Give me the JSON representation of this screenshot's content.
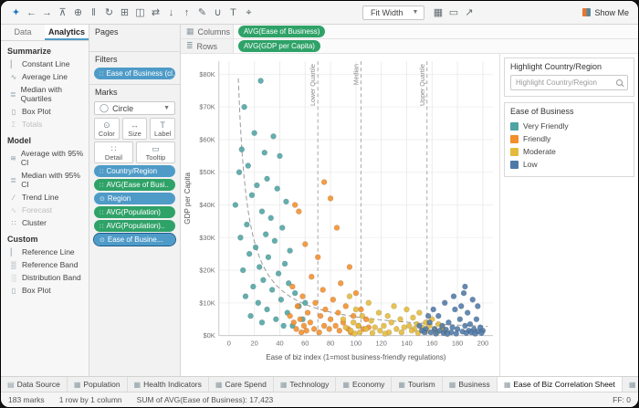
{
  "toolbar": {
    "left_icons": [
      {
        "name": "tableau-logo",
        "glyph": "✦",
        "color": "#1f79c0"
      },
      {
        "name": "undo-icon",
        "glyph": "←"
      },
      {
        "name": "redo-icon",
        "glyph": "→"
      },
      {
        "name": "save-icon",
        "glyph": "⊼"
      },
      {
        "name": "add-data-icon",
        "glyph": "⊕"
      },
      {
        "name": "pause-updates-icon",
        "glyph": "‖"
      },
      {
        "name": "refresh-icon",
        "glyph": "↻"
      },
      {
        "name": "new-worksheet-icon",
        "glyph": "⊞"
      },
      {
        "name": "duplicate-icon",
        "glyph": "◫"
      },
      {
        "name": "swap-axes-icon",
        "glyph": "⇄"
      },
      {
        "name": "sort-ascending-icon",
        "glyph": "↓"
      },
      {
        "name": "sort-descending-icon",
        "glyph": "↑"
      },
      {
        "name": "highlight-icon",
        "glyph": "✎"
      },
      {
        "name": "group-members-icon",
        "glyph": "∪"
      },
      {
        "name": "show-labels-icon",
        "glyph": "T"
      },
      {
        "name": "fix-axes-icon",
        "glyph": "⌖"
      }
    ],
    "fit_label": "Fit Width",
    "right_icons": [
      {
        "name": "show-hide-cards-icon",
        "glyph": "▦"
      },
      {
        "name": "presentation-mode-icon",
        "glyph": "▭"
      },
      {
        "name": "share-icon",
        "glyph": "↗"
      }
    ],
    "show_me_label": "Show Me"
  },
  "sidebar": {
    "tabs": [
      "Data",
      "Analytics"
    ],
    "sections": [
      {
        "title": "Summarize",
        "items": [
          {
            "label": "Constant Line",
            "icon": "constant-line-icon",
            "glyph": "▏",
            "disabled": false
          },
          {
            "label": "Average Line",
            "icon": "average-line-icon",
            "glyph": "∿",
            "disabled": false
          },
          {
            "label": "Median with Quartiles",
            "icon": "median-quartiles-icon",
            "glyph": "≣",
            "disabled": false
          },
          {
            "label": "Box Plot",
            "icon": "box-plot-icon",
            "glyph": "▯",
            "disabled": false
          },
          {
            "label": "Totals",
            "icon": "totals-icon",
            "glyph": "Σ",
            "disabled": true
          }
        ]
      },
      {
        "title": "Model",
        "items": [
          {
            "label": "Average with 95% CI",
            "icon": "average-ci-icon",
            "glyph": "≋",
            "disabled": false
          },
          {
            "label": "Median with 95% CI",
            "icon": "median-ci-icon",
            "glyph": "≣",
            "disabled": false
          },
          {
            "label": "Trend Line",
            "icon": "trend-line-icon",
            "glyph": "∕",
            "disabled": false
          },
          {
            "label": "Forecast",
            "icon": "forecast-icon",
            "glyph": "∿",
            "disabled": true
          },
          {
            "label": "Cluster",
            "icon": "cluster-icon",
            "glyph": "∷",
            "disabled": false
          }
        ]
      },
      {
        "title": "Custom",
        "items": [
          {
            "label": "Reference Line",
            "icon": "reference-line-icon",
            "glyph": "▏",
            "disabled": false
          },
          {
            "label": "Reference Band",
            "icon": "reference-band-icon",
            "glyph": "▒",
            "disabled": false
          },
          {
            "label": "Distribution Band",
            "icon": "distribution-band-icon",
            "glyph": "░",
            "disabled": false
          },
          {
            "label": "Box Plot",
            "icon": "box-plot-icon",
            "glyph": "▯",
            "disabled": false
          }
        ]
      }
    ]
  },
  "panel": {
    "pages_title": "Pages",
    "filters_title": "Filters",
    "filter_pill": "Ease of Business (cl..",
    "marks": {
      "title": "Marks",
      "mark_type": "Circle",
      "buttons_row1": [
        {
          "label": "Color",
          "icon": "color-icon",
          "glyph": "⊙"
        },
        {
          "label": "Size",
          "icon": "size-icon",
          "glyph": "↔"
        },
        {
          "label": "Label",
          "icon": "label-icon",
          "glyph": "T"
        }
      ],
      "buttons_row2": [
        {
          "label": "Detail",
          "icon": "detail-icon",
          "glyph": "∷"
        },
        {
          "label": "Tooltip",
          "icon": "tooltip-icon",
          "glyph": "▭"
        }
      ],
      "pills": [
        {
          "label": "Country/Region",
          "kind": "blue",
          "icon": "detail-icon",
          "glyph": "∷",
          "selected": false
        },
        {
          "label": "AVG(Ease of Busi..",
          "kind": "green",
          "icon": "detail-icon",
          "glyph": "∷",
          "selected": false
        },
        {
          "label": "Region",
          "kind": "blue",
          "icon": "color-icon",
          "glyph": "⊙",
          "selected": false
        },
        {
          "label": "AVG(Population)",
          "kind": "green",
          "icon": "detail-icon",
          "glyph": "∷",
          "selected": false
        },
        {
          "label": "AVG(Population)..",
          "kind": "green",
          "icon": "detail-icon",
          "glyph": "∷",
          "selected": false
        },
        {
          "label": "Ease of Busine...",
          "kind": "blue",
          "icon": "color-icon",
          "glyph": "⊙",
          "selected": true
        }
      ]
    }
  },
  "shelves": {
    "columns_label": "Columns",
    "rows_label": "Rows",
    "columns_pill": "AVG(Ease of Business)",
    "rows_pill": "AVG(GDP per Capita)"
  },
  "cards": {
    "highlight": {
      "title": "Highlight Country/Region",
      "placeholder": "Highlight Country/Region"
    },
    "legend": {
      "title": "Ease of Business",
      "items": [
        {
          "label": "Very Friendly",
          "color": "#4FA3A3"
        },
        {
          "label": "Friendly",
          "color": "#F28E2B"
        },
        {
          "label": "Moderate",
          "color": "#E3BA3C"
        },
        {
          "label": "Low",
          "color": "#4E79A7"
        }
      ]
    }
  },
  "tabs": {
    "items": [
      "Data Source",
      "Population",
      "Health Indicators",
      "Care Spend",
      "Technology",
      "Economy",
      "Tourism",
      "Business",
      "Ease of Biz Correlation Sheet",
      "Global Indicators"
    ],
    "active_index": 8,
    "right_icons": [
      {
        "name": "new-worksheet-tab-icon",
        "glyph": "⊞"
      },
      {
        "name": "new-dashboard-tab-icon",
        "glyph": "◫"
      },
      {
        "name": "new-story-tab-icon",
        "glyph": "▦"
      }
    ]
  },
  "status": {
    "left_items": [
      "183 marks",
      "1 row by 1 column",
      "SUM of AVG(Ease of Business): 17,423"
    ],
    "right_text": "FF: 0"
  },
  "chart_data": {
    "type": "scatter",
    "title": "",
    "xlabel": "Ease of biz index (1=most business-friendly regulations)",
    "ylabel": "GDP per Capita",
    "xlim": [
      -8,
      208
    ],
    "ylim": [
      0,
      84
    ],
    "x_ticks": [
      0,
      20,
      40,
      60,
      80,
      100,
      120,
      140,
      160,
      180,
      200
    ],
    "y_ticks": [
      0,
      10,
      20,
      30,
      40,
      50,
      60,
      70,
      80
    ],
    "y_tick_prefix": "$",
    "y_tick_suffix": "K",
    "grid": true,
    "legend_position": "right",
    "reference_lines": [
      {
        "x": 70,
        "label": "Lower Quartile"
      },
      {
        "x": 104,
        "label": "Median"
      },
      {
        "x": 156,
        "label": "Upper Quartile"
      }
    ],
    "trend_line": {
      "type": "power-decay",
      "k": 575,
      "x_start": 7.3,
      "x_end": 205,
      "style": "dashed"
    },
    "series": [
      {
        "name": "Very Friendly",
        "color": "#4FA3A3",
        "points": [
          [
            25,
            78
          ],
          [
            12,
            70
          ],
          [
            20,
            62
          ],
          [
            35,
            61
          ],
          [
            10,
            57
          ],
          [
            28,
            56
          ],
          [
            40,
            55
          ],
          [
            15,
            52
          ],
          [
            8,
            50
          ],
          [
            30,
            48
          ],
          [
            22,
            46
          ],
          [
            38,
            45
          ],
          [
            18,
            43
          ],
          [
            45,
            41
          ],
          [
            5,
            40
          ],
          [
            26,
            38
          ],
          [
            33,
            36
          ],
          [
            14,
            34
          ],
          [
            42,
            33
          ],
          [
            29,
            31
          ],
          [
            9,
            30
          ],
          [
            36,
            29
          ],
          [
            21,
            27
          ],
          [
            48,
            26
          ],
          [
            16,
            25
          ],
          [
            31,
            24
          ],
          [
            44,
            22
          ],
          [
            24,
            21
          ],
          [
            11,
            20
          ],
          [
            39,
            19
          ],
          [
            27,
            17
          ],
          [
            47,
            16
          ],
          [
            19,
            15
          ],
          [
            34,
            14
          ],
          [
            52,
            13
          ],
          [
            13,
            12
          ],
          [
            41,
            11
          ],
          [
            23,
            10
          ],
          [
            55,
            9
          ],
          [
            30,
            8
          ],
          [
            46,
            7
          ],
          [
            17,
            6
          ],
          [
            37,
            5
          ],
          [
            58,
            5
          ],
          [
            26,
            4
          ],
          [
            50,
            3
          ],
          [
            60,
            10
          ],
          [
            43,
            3
          ]
        ]
      },
      {
        "name": "Friendly",
        "color": "#F28E2B",
        "points": [
          [
            75,
            47
          ],
          [
            80,
            42
          ],
          [
            52,
            40
          ],
          [
            55,
            38
          ],
          [
            85,
            33
          ],
          [
            60,
            28
          ],
          [
            70,
            24
          ],
          [
            95,
            21
          ],
          [
            65,
            18
          ],
          [
            88,
            16
          ],
          [
            50,
            15
          ],
          [
            74,
            14
          ],
          [
            100,
            13
          ],
          [
            58,
            12
          ],
          [
            82,
            11
          ],
          [
            68,
            10
          ],
          [
            92,
            9
          ],
          [
            54,
            9
          ],
          [
            76,
            8
          ],
          [
            104,
            8
          ],
          [
            62,
            7
          ],
          [
            86,
            7
          ],
          [
            48,
            6
          ],
          [
            72,
            6
          ],
          [
            98,
            6
          ],
          [
            56,
            5
          ],
          [
            80,
            5
          ],
          [
            108,
            5
          ],
          [
            64,
            4
          ],
          [
            90,
            4
          ],
          [
            51,
            4
          ],
          [
            75,
            3
          ],
          [
            102,
            3
          ],
          [
            59,
            3
          ],
          [
            84,
            3
          ],
          [
            67,
            2
          ],
          [
            94,
            2
          ],
          [
            53,
            2
          ],
          [
            79,
            2
          ],
          [
            106,
            2
          ],
          [
            61,
            1.5
          ],
          [
            87,
            1.5
          ],
          [
            71,
            1
          ],
          [
            96,
            1
          ],
          [
            57,
            1
          ],
          [
            110,
            2.5
          ]
        ]
      },
      {
        "name": "Moderate",
        "color": "#E3BA3C",
        "points": [
          [
            95,
            12
          ],
          [
            110,
            10
          ],
          [
            130,
            9
          ],
          [
            100,
            8
          ],
          [
            140,
            8
          ],
          [
            118,
            7
          ],
          [
            150,
            7
          ],
          [
            105,
            6
          ],
          [
            125,
            6
          ],
          [
            145,
            5.5
          ],
          [
            160,
            5
          ],
          [
            90,
            5
          ],
          [
            135,
            5
          ],
          [
            112,
            4.5
          ],
          [
            155,
            4
          ],
          [
            98,
            4
          ],
          [
            128,
            4
          ],
          [
            148,
            3.5
          ],
          [
            165,
            3.5
          ],
          [
            102,
            3
          ],
          [
            122,
            3
          ],
          [
            142,
            3
          ],
          [
            158,
            3
          ],
          [
            92,
            2.5
          ],
          [
            115,
            2.5
          ],
          [
            138,
            2.5
          ],
          [
            152,
            2.5
          ],
          [
            168,
            2.5
          ],
          [
            108,
            2
          ],
          [
            132,
            2
          ],
          [
            146,
            2
          ],
          [
            162,
            2
          ],
          [
            96,
            1.5
          ],
          [
            119,
            1.5
          ],
          [
            144,
            1.5
          ],
          [
            156,
            1.5
          ],
          [
            103,
            1
          ],
          [
            126,
            1
          ],
          [
            136,
            1
          ],
          [
            164,
            1
          ],
          [
            113,
            0.8
          ],
          [
            149,
            0.8
          ],
          [
            99,
            0.6
          ],
          [
            123,
            0.6
          ],
          [
            170,
            1.2
          ]
        ]
      },
      {
        "name": "Low",
        "color": "#4E79A7",
        "points": [
          [
            185,
            13
          ],
          [
            192,
            11
          ],
          [
            170,
            10
          ],
          [
            196,
            9
          ],
          [
            178,
            8
          ],
          [
            188,
            7
          ],
          [
            165,
            6
          ],
          [
            182,
            5
          ],
          [
            195,
            5
          ],
          [
            158,
            4
          ],
          [
            173,
            4
          ],
          [
            190,
            3.5
          ],
          [
            168,
            3
          ],
          [
            186,
            3
          ],
          [
            176,
            2.5
          ],
          [
            198,
            2.5
          ],
          [
            162,
            2
          ],
          [
            180,
            2
          ],
          [
            193,
            2
          ],
          [
            155,
            2
          ],
          [
            171,
            1.8
          ],
          [
            189,
            1.5
          ],
          [
            166,
            1.5
          ],
          [
            184,
            1.2
          ],
          [
            196,
            1.2
          ],
          [
            159,
            1
          ],
          [
            175,
            1
          ],
          [
            191,
            1
          ],
          [
            169,
            0.8
          ],
          [
            187,
            0.8
          ],
          [
            179,
            0.6
          ],
          [
            200,
            1.5
          ],
          [
            152,
            1.5
          ],
          [
            163,
            0.6
          ],
          [
            172,
            0.5
          ],
          [
            194,
            0.6
          ],
          [
            150,
            3
          ],
          [
            157,
            6
          ],
          [
            183,
            9
          ],
          [
            199,
            0.8
          ],
          [
            161,
            8
          ],
          [
            177,
            12
          ],
          [
            186,
            15
          ],
          [
            154,
            1
          ]
        ]
      }
    ]
  }
}
